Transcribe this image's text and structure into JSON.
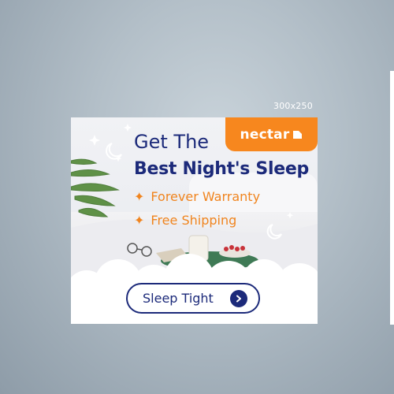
{
  "canvas": {
    "size_label": "300x250"
  },
  "ad": {
    "brand": "nectar",
    "headline_line1": "Get The",
    "headline_line2": "Best Night's Sleep",
    "benefits": [
      "Forever Warranty",
      "Free Shipping"
    ],
    "benefit_bullet": "✦",
    "cta_label": "Sleep Tight",
    "colors": {
      "navy": "#1c2a7a",
      "orange": "#f0841e",
      "logo_bg": "#f7871e",
      "white": "#ffffff"
    },
    "icons": [
      "moon-icon",
      "sparkle-icon",
      "cloud-icon",
      "logo-mark-icon",
      "chevron-right-icon"
    ]
  }
}
